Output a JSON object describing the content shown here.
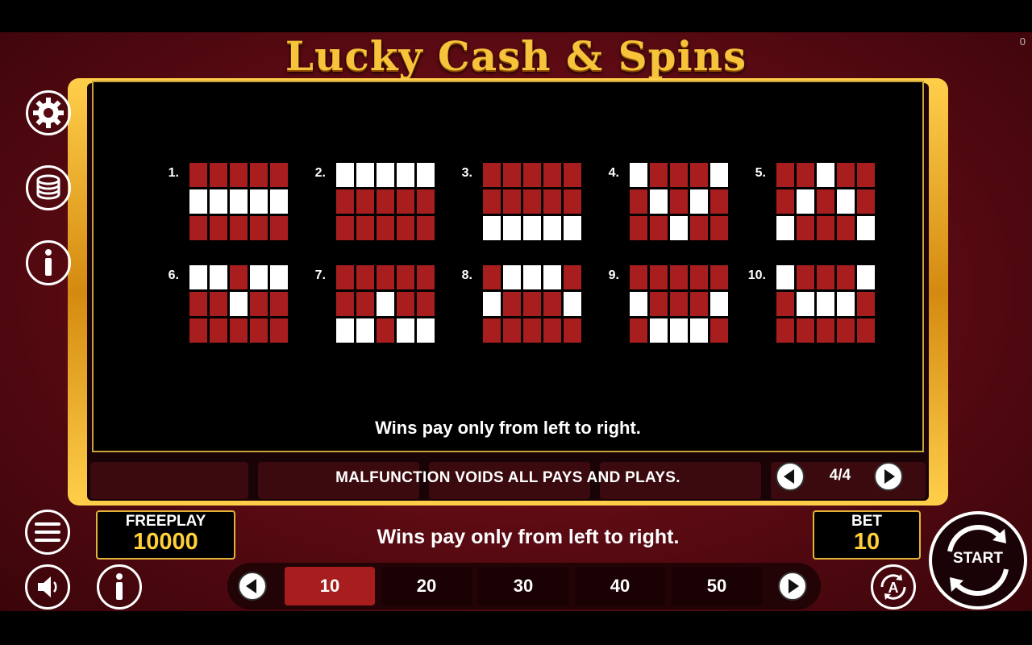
{
  "game": {
    "title": "Lucky Cash & Spins",
    "counter": "0"
  },
  "paylines": {
    "footer_text": "Wins pay only from left to right.",
    "lines": [
      {
        "number": "1.",
        "rows": [
          [
            0,
            0,
            0,
            0,
            0
          ],
          [
            1,
            1,
            1,
            1,
            1
          ],
          [
            0,
            0,
            0,
            0,
            0
          ]
        ]
      },
      {
        "number": "2.",
        "rows": [
          [
            1,
            1,
            1,
            1,
            1
          ],
          [
            0,
            0,
            0,
            0,
            0
          ],
          [
            0,
            0,
            0,
            0,
            0
          ]
        ]
      },
      {
        "number": "3.",
        "rows": [
          [
            0,
            0,
            0,
            0,
            0
          ],
          [
            0,
            0,
            0,
            0,
            0
          ],
          [
            1,
            1,
            1,
            1,
            1
          ]
        ]
      },
      {
        "number": "4.",
        "rows": [
          [
            1,
            0,
            0,
            0,
            1
          ],
          [
            0,
            1,
            0,
            1,
            0
          ],
          [
            0,
            0,
            1,
            0,
            0
          ]
        ]
      },
      {
        "number": "5.",
        "rows": [
          [
            0,
            0,
            1,
            0,
            0
          ],
          [
            0,
            1,
            0,
            1,
            0
          ],
          [
            1,
            0,
            0,
            0,
            1
          ]
        ]
      },
      {
        "number": "6.",
        "rows": [
          [
            1,
            1,
            0,
            1,
            1
          ],
          [
            0,
            0,
            1,
            0,
            0
          ],
          [
            0,
            0,
            0,
            0,
            0
          ]
        ]
      },
      {
        "number": "7.",
        "rows": [
          [
            0,
            0,
            0,
            0,
            0
          ],
          [
            0,
            0,
            1,
            0,
            0
          ],
          [
            1,
            1,
            0,
            1,
            1
          ]
        ]
      },
      {
        "number": "8.",
        "rows": [
          [
            0,
            1,
            1,
            1,
            0
          ],
          [
            1,
            0,
            0,
            0,
            1
          ],
          [
            0,
            0,
            0,
            0,
            0
          ]
        ]
      },
      {
        "number": "9.",
        "rows": [
          [
            0,
            0,
            0,
            0,
            0
          ],
          [
            1,
            0,
            0,
            0,
            1
          ],
          [
            0,
            1,
            1,
            1,
            0
          ]
        ]
      },
      {
        "number": "10.",
        "rows": [
          [
            1,
            0,
            0,
            0,
            1
          ],
          [
            0,
            1,
            1,
            1,
            0
          ],
          [
            0,
            0,
            0,
            0,
            0
          ]
        ]
      }
    ]
  },
  "malfunction_text": "MALFUNCTION VOIDS ALL PAYS AND PLAYS.",
  "pager": {
    "label": "4/4"
  },
  "freeplay": {
    "label": "FREEPLAY",
    "value": "10000"
  },
  "bet": {
    "label": "BET",
    "value": "10"
  },
  "message": "Wins pay only from left to right.",
  "bet_options": [
    "10",
    "20",
    "30",
    "40",
    "50"
  ],
  "selected_bet": "10",
  "start_label": "START",
  "autoplay_letter": "A",
  "colors": {
    "accent": "#a81e1e",
    "gold": "#ffd03a",
    "lit": "#ffffff"
  }
}
